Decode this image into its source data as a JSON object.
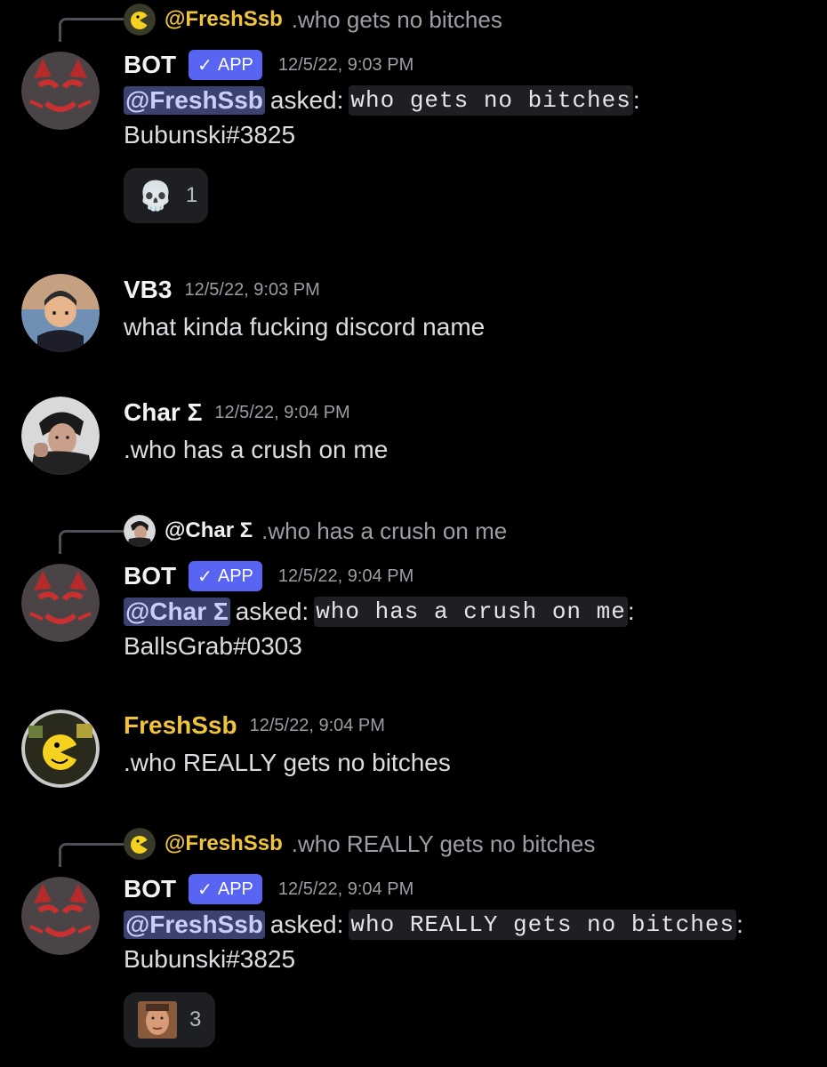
{
  "colors": {
    "background": "#000000",
    "mention_bg": "#3c4270",
    "app_badge": "#5865f2",
    "freshssb_name": "#f0c43a",
    "timestamp": "#9b9ea4"
  },
  "messages": [
    {
      "reply": {
        "name": "@FreshSsb",
        "text": ".who gets no bitches",
        "avatar_icon": "pacman-avatar-icon"
      },
      "author": "BOT",
      "badge": "APP",
      "timestamp": "12/5/22, 9:03 PM",
      "mention": "@FreshSsb",
      "asked": "asked:",
      "code": "who gets no bitches",
      "colon": ":",
      "line2": "Bubunski#3825",
      "reaction": {
        "emoji_icon": "skull-icon",
        "emoji": "💀",
        "count": "1"
      }
    },
    {
      "author": "VB3",
      "timestamp": "12/5/22, 9:03 PM",
      "text": "what kinda fucking discord name"
    },
    {
      "author": "Char Σ",
      "timestamp": "12/5/22, 9:04 PM",
      "text": ".who has a crush on me"
    },
    {
      "reply": {
        "name": "@Char Σ",
        "text": ".who has a crush on me",
        "avatar_icon": "char-avatar-icon"
      },
      "author": "BOT",
      "badge": "APP",
      "timestamp": "12/5/22, 9:04 PM",
      "mention": "@Char Σ",
      "asked": "asked:",
      "code": "who has a crush on me",
      "colon": ":",
      "line2": "BallsGrab#0303"
    },
    {
      "author": "FreshSsb",
      "timestamp": "12/5/22, 9:04 PM",
      "text": ".who REALLY gets no bitches"
    },
    {
      "reply": {
        "name": "@FreshSsb",
        "text": ".who REALLY gets no bitches",
        "avatar_icon": "pacman-avatar-icon"
      },
      "author": "BOT",
      "badge": "APP",
      "timestamp": "12/5/22, 9:04 PM",
      "mention": "@FreshSsb",
      "asked": "asked:",
      "code": "who REALLY gets no bitches",
      "colon": ":",
      "line2": "Bubunski#3825",
      "reaction": {
        "emoji_icon": "face-emoji-icon",
        "count": "3"
      }
    }
  ]
}
